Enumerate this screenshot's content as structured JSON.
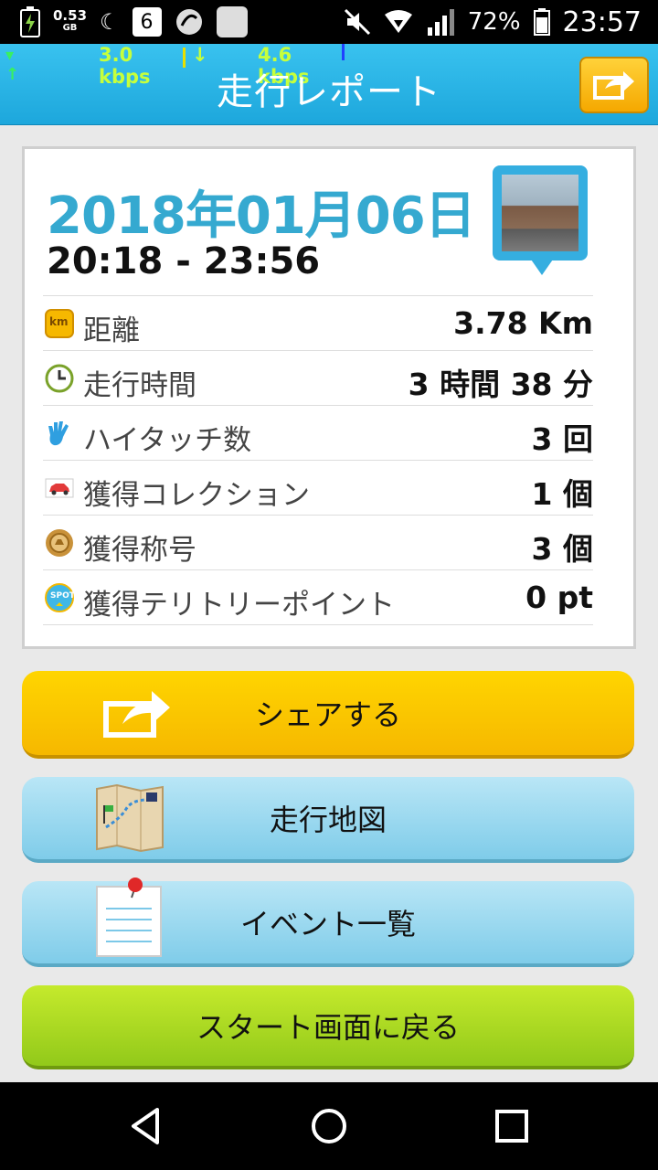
{
  "status_bar": {
    "data_gb_value": "0.53",
    "data_gb_unit": "GB",
    "notification_number": "6",
    "battery_percent": "72%",
    "time": "23:57"
  },
  "network_speed": {
    "upload": "3.0 kbps",
    "download": "4.6 kbps"
  },
  "header": {
    "title": "走行レポート"
  },
  "report": {
    "date": "2018年01月06日",
    "time_range": "20:18 - 23:56",
    "rows": [
      {
        "icon": "km-icon",
        "label": "距離",
        "value": "3.78 Km"
      },
      {
        "icon": "clock-icon",
        "label": "走行時間",
        "value": "3 時間 38 分"
      },
      {
        "icon": "high-five-icon",
        "label": "ハイタッチ数",
        "value": "3 回"
      },
      {
        "icon": "car-icon",
        "label": "獲得コレクション",
        "value": "1 個"
      },
      {
        "icon": "medal-icon",
        "label": "獲得称号",
        "value": "3 個"
      },
      {
        "icon": "spot-icon",
        "label": "獲得テリトリーポイント",
        "value": "0 pt"
      }
    ],
    "km_badge": "km",
    "spot_badge": "SPOT"
  },
  "buttons": {
    "share": "シェアする",
    "map": "走行地図",
    "events": "イベント一覧",
    "start": "スタート画面に戻る"
  },
  "colors": {
    "header": "#1da7dc",
    "date_text": "#35a9d0",
    "share_button": "#f6b800",
    "blue_button": "#7fcce9",
    "start_button": "#92c91a"
  }
}
